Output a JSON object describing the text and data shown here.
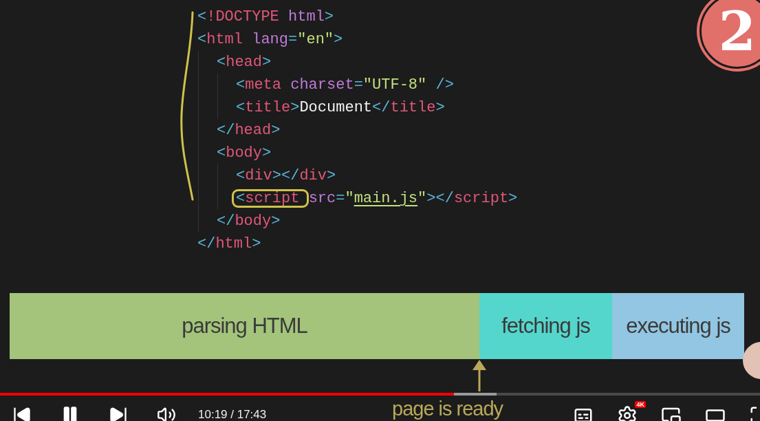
{
  "logo": {
    "text": "2"
  },
  "code": [
    {
      "tokens": [
        {
          "kind": "punct",
          "text": "<"
        },
        {
          "kind": "tag",
          "text": "!DOCTYPE"
        },
        {
          "kind": "attr",
          "text": " html"
        },
        {
          "kind": "punct",
          "text": ">"
        }
      ]
    },
    {
      "tokens": [
        {
          "kind": "punct",
          "text": "<"
        },
        {
          "kind": "tag",
          "text": "html"
        },
        {
          "kind": "attr",
          "text": " lang"
        },
        {
          "kind": "punct",
          "text": "="
        },
        {
          "kind": "string",
          "text": "\"en\""
        },
        {
          "kind": "punct",
          "text": ">"
        }
      ],
      "children": [
        {
          "tokens": [
            {
              "kind": "punct",
              "text": "<"
            },
            {
              "kind": "tag",
              "text": "head"
            },
            {
              "kind": "punct",
              "text": ">"
            }
          ],
          "children": [
            {
              "tokens": [
                {
                  "kind": "punct",
                  "text": "<"
                },
                {
                  "kind": "tag",
                  "text": "meta"
                },
                {
                  "kind": "attr",
                  "text": " charset"
                },
                {
                  "kind": "punct",
                  "text": "="
                },
                {
                  "kind": "string",
                  "text": "\"UTF-8\""
                },
                {
                  "kind": "punct",
                  "text": " />"
                }
              ]
            },
            {
              "tokens": [
                {
                  "kind": "punct",
                  "text": "<"
                },
                {
                  "kind": "tag",
                  "text": "title"
                },
                {
                  "kind": "punct",
                  "text": ">"
                },
                {
                  "kind": "text",
                  "text": "Document"
                },
                {
                  "kind": "punct",
                  "text": "</"
                },
                {
                  "kind": "tag",
                  "text": "title"
                },
                {
                  "kind": "punct",
                  "text": ">"
                }
              ]
            }
          ]
        },
        {
          "tokens": [
            {
              "kind": "punct",
              "text": "</"
            },
            {
              "kind": "tag",
              "text": "head"
            },
            {
              "kind": "punct",
              "text": ">"
            }
          ]
        },
        {
          "tokens": [
            {
              "kind": "punct",
              "text": "<"
            },
            {
              "kind": "tag",
              "text": "body"
            },
            {
              "kind": "punct",
              "text": ">"
            }
          ],
          "children": [
            {
              "tokens": [
                {
                  "kind": "punct",
                  "text": "<"
                },
                {
                  "kind": "tag",
                  "text": "div"
                },
                {
                  "kind": "punct",
                  "text": "></"
                },
                {
                  "kind": "tag",
                  "text": "div"
                },
                {
                  "kind": "punct",
                  "text": ">"
                }
              ]
            },
            {
              "tokens": [
                {
                  "kind": "punct",
                  "text": "<",
                  "circled": true
                },
                {
                  "kind": "tag",
                  "text": "script ",
                  "circled": true
                },
                {
                  "kind": "attr",
                  "text": "src"
                },
                {
                  "kind": "punct",
                  "text": "="
                },
                {
                  "kind": "string",
                  "text": "\""
                },
                {
                  "kind": "link",
                  "text": "main.js"
                },
                {
                  "kind": "string",
                  "text": "\""
                },
                {
                  "kind": "punct",
                  "text": "></"
                },
                {
                  "kind": "tag",
                  "text": "script"
                },
                {
                  "kind": "punct",
                  "text": ">"
                }
              ]
            }
          ]
        },
        {
          "tokens": [
            {
              "kind": "punct",
              "text": "</"
            },
            {
              "kind": "tag",
              "text": "body"
            },
            {
              "kind": "punct",
              "text": ">"
            }
          ]
        }
      ]
    },
    {
      "tokens": [
        {
          "kind": "punct",
          "text": "</"
        },
        {
          "kind": "tag",
          "text": "html"
        },
        {
          "kind": "punct",
          "text": ">"
        }
      ]
    }
  ],
  "timeline": [
    {
      "label": "parsing HTML",
      "color": "#a3c47a"
    },
    {
      "label": "fetching js",
      "color": "#55d6cc"
    },
    {
      "label": "executing js",
      "color": "#92c6e2"
    }
  ],
  "annotation": {
    "text": "page is ready"
  },
  "player": {
    "progress": {
      "level": 0.597
    },
    "time": "10:19 / 17:43",
    "quality_badge": "4K"
  }
}
